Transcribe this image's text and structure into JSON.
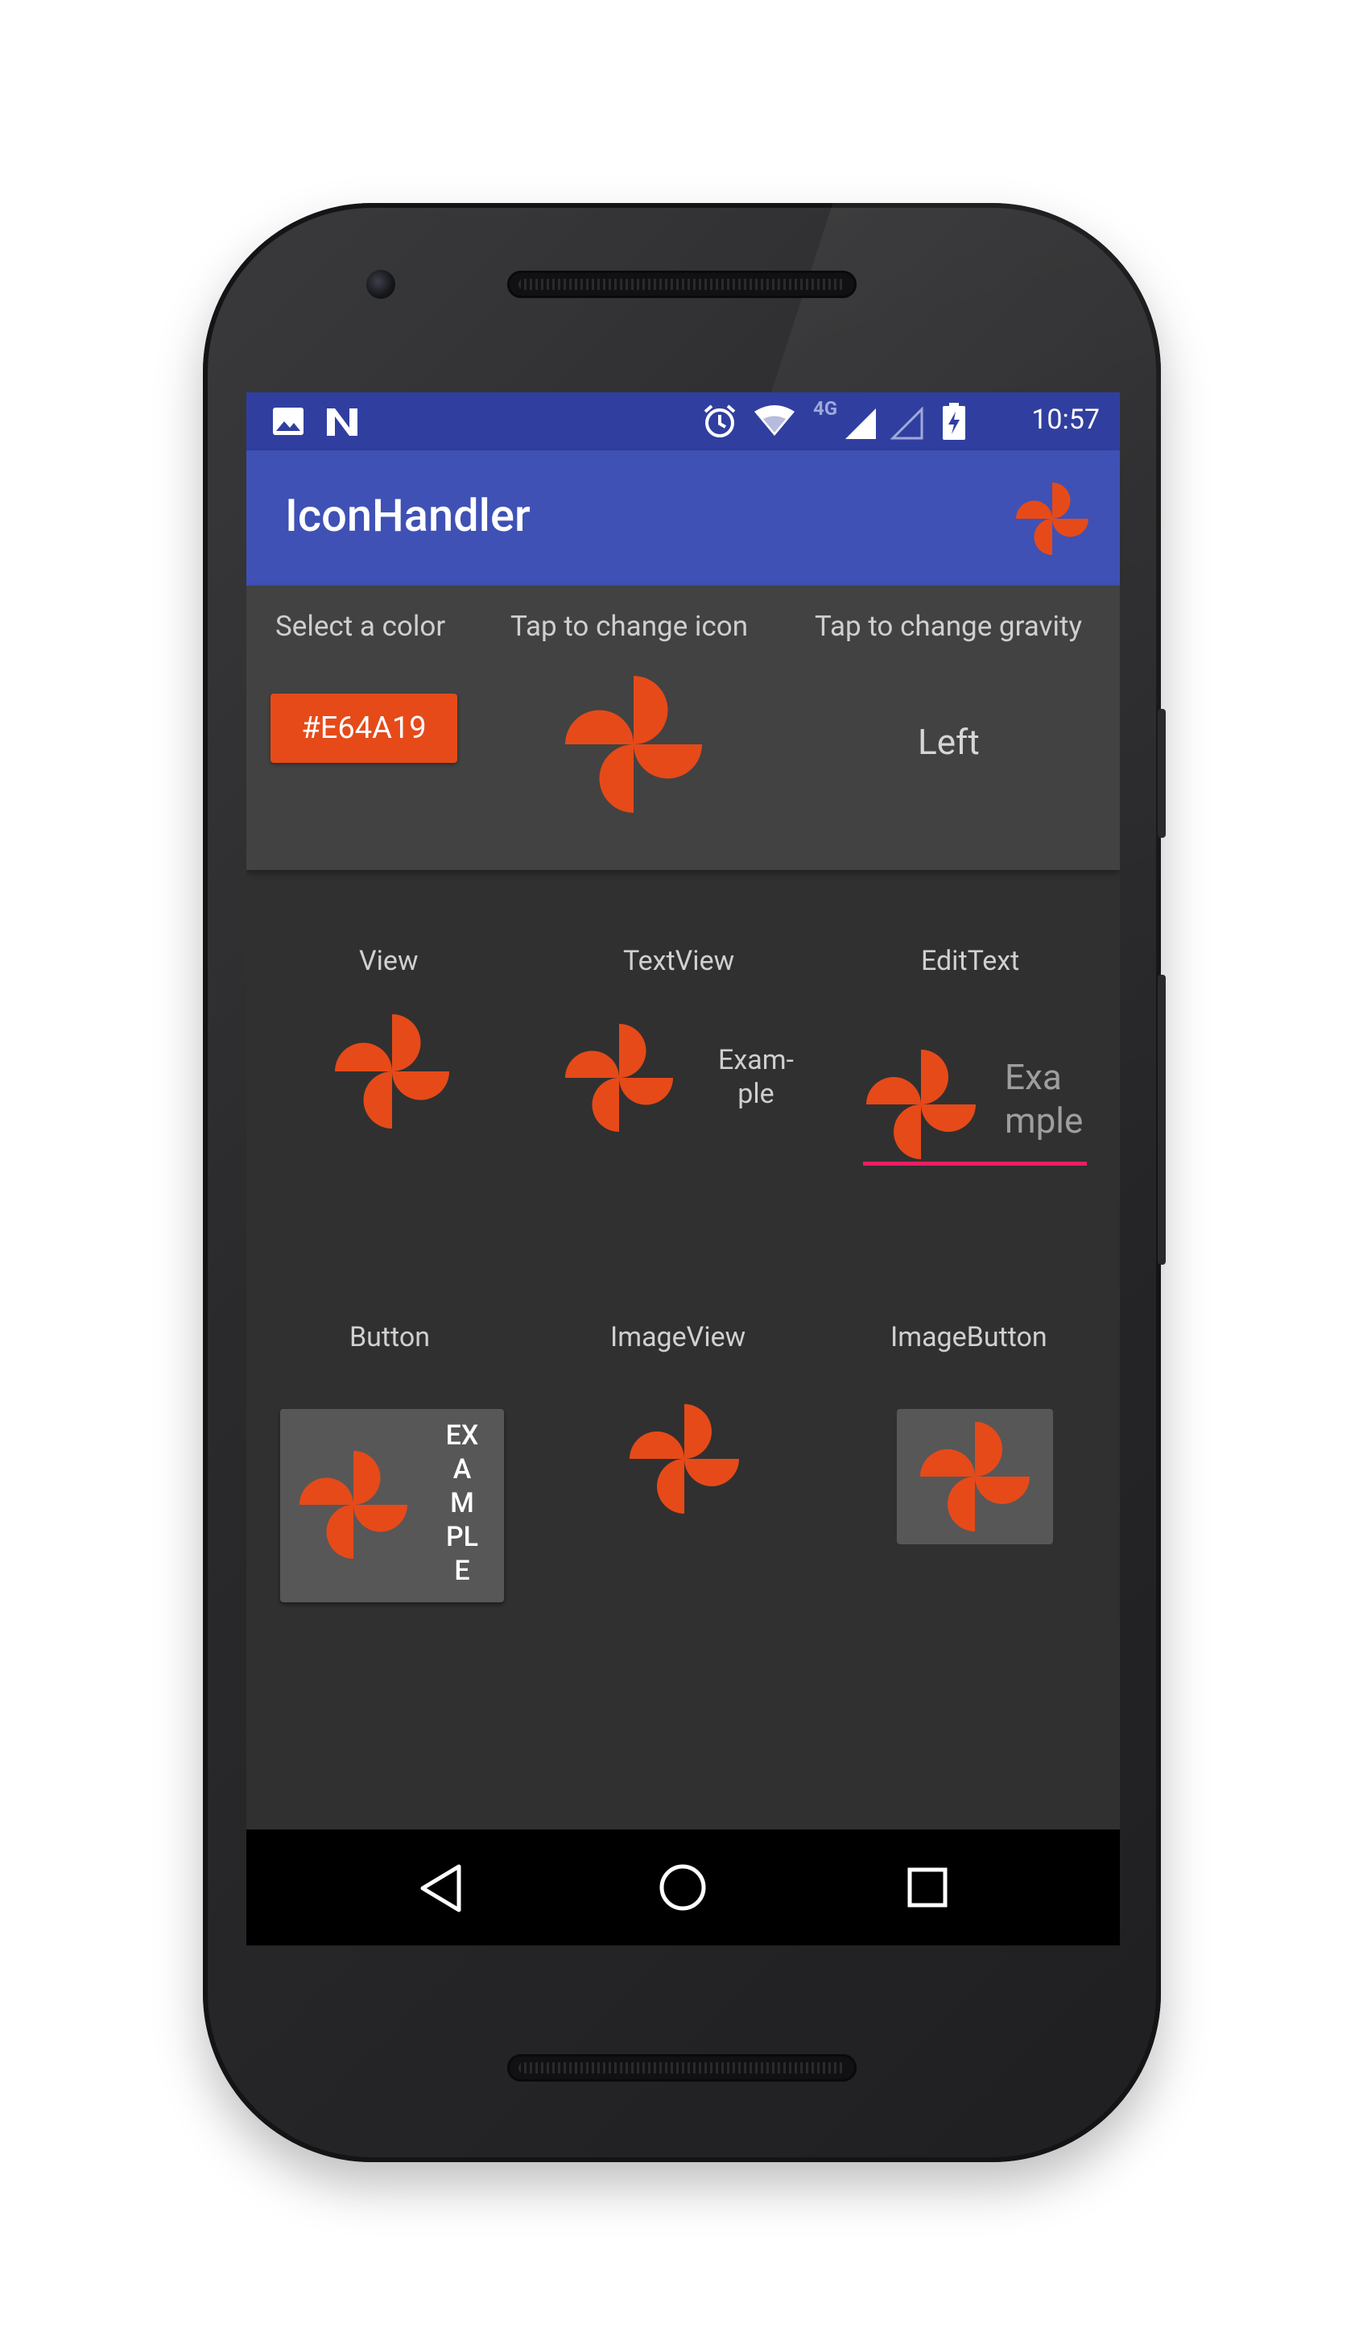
{
  "status_bar": {
    "time": "10:57",
    "network": "4G",
    "icons": [
      "image-icon",
      "n-logo-icon",
      "alarm-icon",
      "wifi-icon",
      "signal-icon",
      "signal-empty-icon",
      "battery-charging-icon"
    ]
  },
  "app_bar": {
    "title": "IconHandler",
    "action_icon": "pinwheel-icon"
  },
  "controls": {
    "color_label": "Select a color",
    "color_value": "#E64A19",
    "icon_label": "Tap to change icon",
    "gravity_label": "Tap to change gravity",
    "gravity_value": "Left"
  },
  "demos": {
    "view": {
      "label": "View"
    },
    "textview": {
      "label": "TextView",
      "text_line1": "Exam-",
      "text_line2": "ple"
    },
    "edittext": {
      "label": "EditText",
      "text_line1": "Exa",
      "text_line2": "mple"
    },
    "button": {
      "label": "Button",
      "text_lines": [
        "EX",
        "A",
        "M",
        "PL",
        "E"
      ]
    },
    "imageview": {
      "label": "ImageView"
    },
    "imagebutton": {
      "label": "ImageButton"
    }
  },
  "nav_bar": {
    "back_icon": "back-triangle-icon",
    "home_icon": "home-circle-icon",
    "recents_icon": "recents-square-icon"
  },
  "colors": {
    "accent": "#E64A19",
    "primary": "#3F51B5",
    "primary_dark": "#303F9F",
    "edittext_underline": "#E91E63",
    "background": "#303030",
    "card": "#424242"
  }
}
